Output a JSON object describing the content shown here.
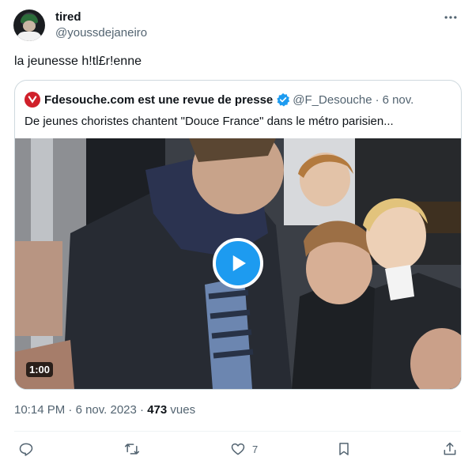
{
  "author": {
    "name": "tired",
    "handle": "@youssdejaneiro"
  },
  "tweet": {
    "text": "la jeunesse h!tl£r!enne"
  },
  "quoted": {
    "name": "Fdesouche.com est une revue de presse",
    "handle": "@F_Desouche",
    "separator": "·",
    "date": "6 nov.",
    "text": "De jeunes choristes chantent \"Douce France\" dans le métro parisien...",
    "video_duration": "1:00"
  },
  "meta": {
    "time": "10:14 PM",
    "sep1": "·",
    "date": "6 nov. 2023",
    "sep2": "·",
    "views_count": "473",
    "views_label": "vues"
  },
  "actions": {
    "reply_count": "",
    "retweet_count": "",
    "like_count": "7"
  },
  "colors": {
    "accent": "#1d9bf0",
    "muted": "#536471",
    "border": "#cfd9de",
    "fdesouche_red": "#d0202a"
  },
  "icons": [
    "more-icon",
    "verified-badge-icon",
    "play-icon",
    "reply-icon",
    "retweet-icon",
    "like-icon",
    "bookmark-icon",
    "share-icon"
  ]
}
